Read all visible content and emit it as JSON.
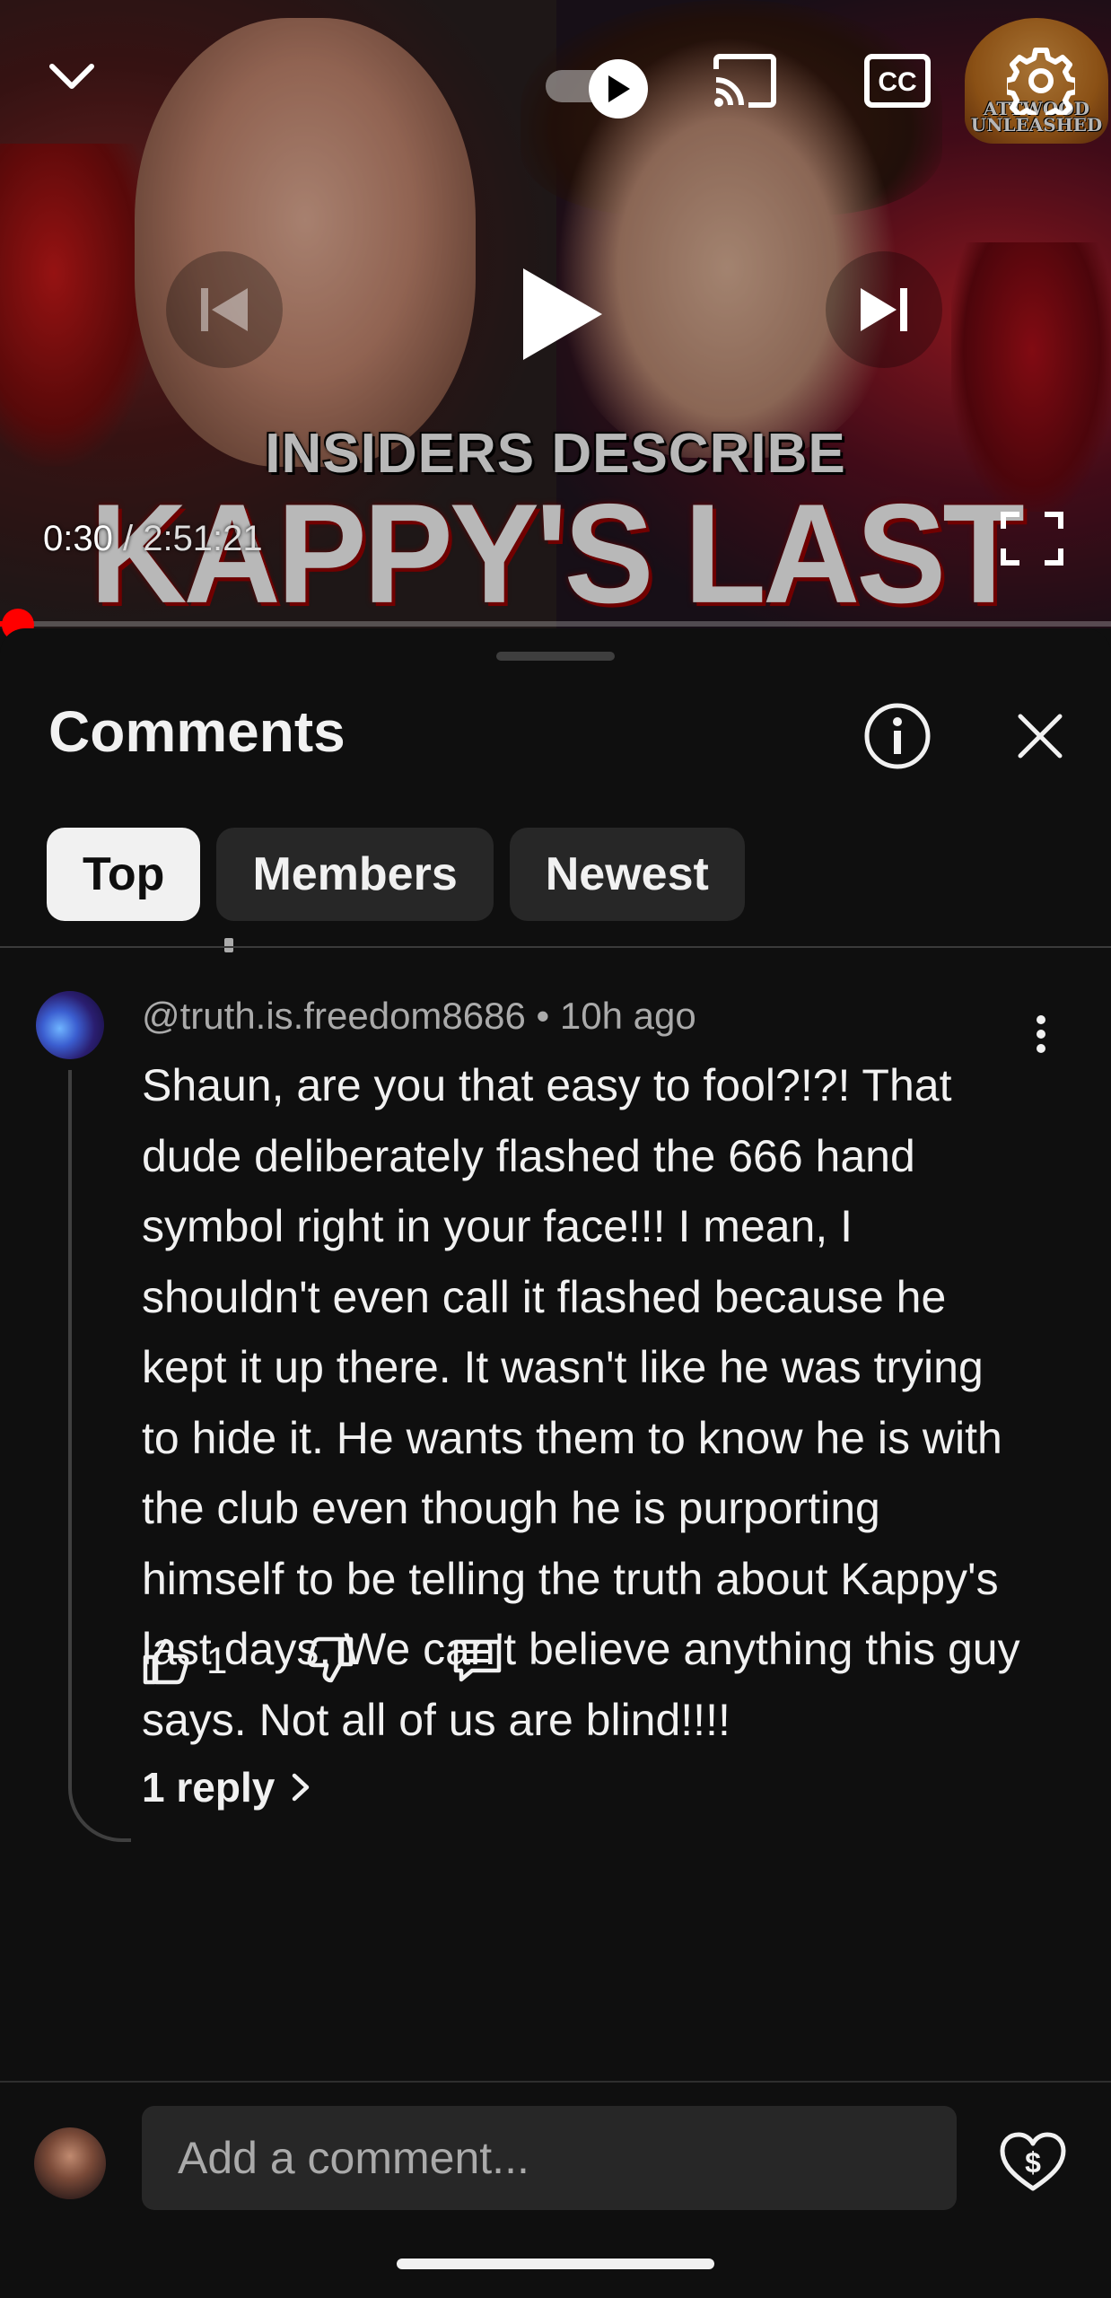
{
  "player": {
    "thumbnail_line1": "INSIDERS DESCRIBE",
    "thumbnail_line2": "KAPPY'S LAST DAYS!",
    "badge_text_1": "ATTWOOD",
    "badge_text_2": "UNLEASHED",
    "time_current": "0:30",
    "time_separator": " / ",
    "time_duration": "2:51:21",
    "progress_fraction": 0.003,
    "icons": [
      "chevron-down-icon",
      "autoplay-toggle-icon",
      "cast-icon",
      "cc-icon",
      "settings-gear-icon",
      "previous-icon",
      "play-icon",
      "next-icon",
      "fullscreen-icon"
    ]
  },
  "comments_panel": {
    "title": "Comments",
    "filters": [
      "Top",
      "Members",
      "Newest"
    ],
    "active_filter": "Top"
  },
  "comment": {
    "author": "@truth.is.freedom8686",
    "separator": " • ",
    "age": "10h ago",
    "text": "Shaun, are you that easy to fool?!?! That dude deliberately flashed the 666 hand symbol right in your face!!! I mean, I shouldn't even call it flashed because he kept it up there. It wasn't like he was trying to hide it. He wants them to know he is with the club even though he is purporting himself to be telling the truth about Kappy's last days. We can't believe anything this guy says. Not all of us are blind!!!!",
    "like_count": "1",
    "replies_label": "1 reply"
  },
  "composer": {
    "placeholder": "Add a comment..."
  },
  "colors": {
    "background": "#0f0f0f",
    "chip_active": "#f1f1f1",
    "chip_inactive": "#272727",
    "progress": "#ff0000",
    "secondary_text": "#aaaaaa"
  }
}
